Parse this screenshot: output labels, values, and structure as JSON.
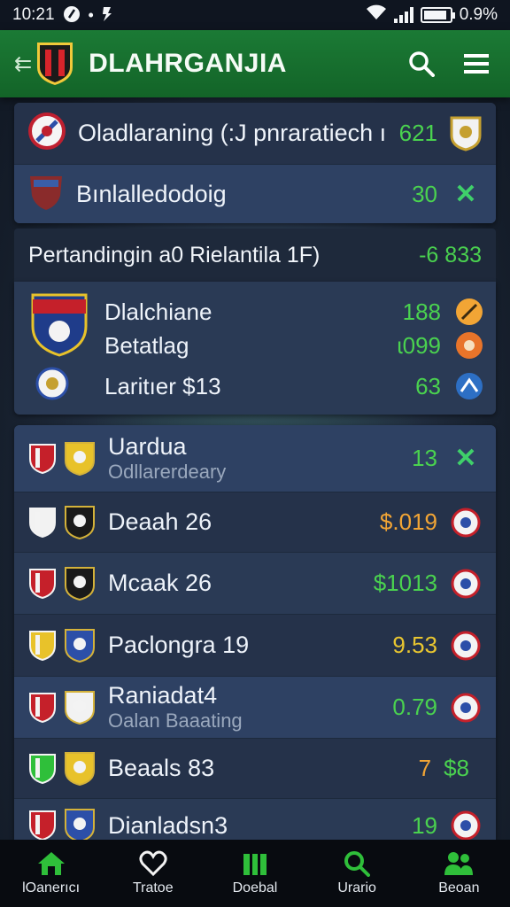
{
  "status_bar": {
    "time": "10:21",
    "battery_text": "0.9%",
    "battery_level": 0.9
  },
  "app_bar": {
    "title": "DLAHRGANJIA"
  },
  "top_card": {
    "rows": [
      {
        "title": "Oladlaraning (:J pnraratiech ı",
        "value": "621"
      },
      {
        "title": "Bınlalledodoig",
        "value": "30"
      }
    ]
  },
  "section": {
    "title": "Pertandingin a0 Rielantila 1F)",
    "value": "-6 833"
  },
  "feature_card": {
    "rows": [
      {
        "title": "Dlalchiane",
        "value": "188"
      },
      {
        "title": "Betatlag",
        "value": "ɩ099"
      },
      {
        "title": "Laritıer $13",
        "value": "63"
      }
    ]
  },
  "matches": [
    {
      "title": "Uardua",
      "sub": "Odllarerdeary",
      "value": "13",
      "value_color": "green",
      "right": "x"
    },
    {
      "title": "Deaah 26",
      "sub": "",
      "value": "$.019",
      "value_color": "orange",
      "right": "crest"
    },
    {
      "title": "Mcaak 26",
      "sub": "",
      "value": "$1013",
      "value_color": "green",
      "right": "crest"
    },
    {
      "title": "Paclongra 19",
      "sub": "",
      "value": "9.53",
      "value_color": "yellow",
      "right": "crest"
    },
    {
      "title": "Raniadat4",
      "sub": "Oalan Baaating",
      "value": "0.79",
      "value_color": "green",
      "right": "crest"
    },
    {
      "title": "Beaals 83",
      "sub": "",
      "value": "7",
      "value2": "$8",
      "value_color": "orange",
      "right": "none"
    },
    {
      "title": "Dianladsn3",
      "sub": "",
      "value": "19",
      "value_color": "green",
      "right": "crest"
    }
  ],
  "bottom_nav": [
    {
      "label": "lOanerıcı",
      "icon": "home-icon"
    },
    {
      "label": "Tratoe",
      "icon": "heart-icon"
    },
    {
      "label": "Doebal",
      "icon": "stats-icon"
    },
    {
      "label": "Urario",
      "icon": "search-icon"
    },
    {
      "label": "Beoan",
      "icon": "people-icon"
    }
  ],
  "colors": {
    "app_bar": "#1b7a35",
    "accent_green": "#4ad24f",
    "accent_orange": "#f2a535",
    "card": "#2a3a55",
    "nav_bg": "#080b10"
  }
}
